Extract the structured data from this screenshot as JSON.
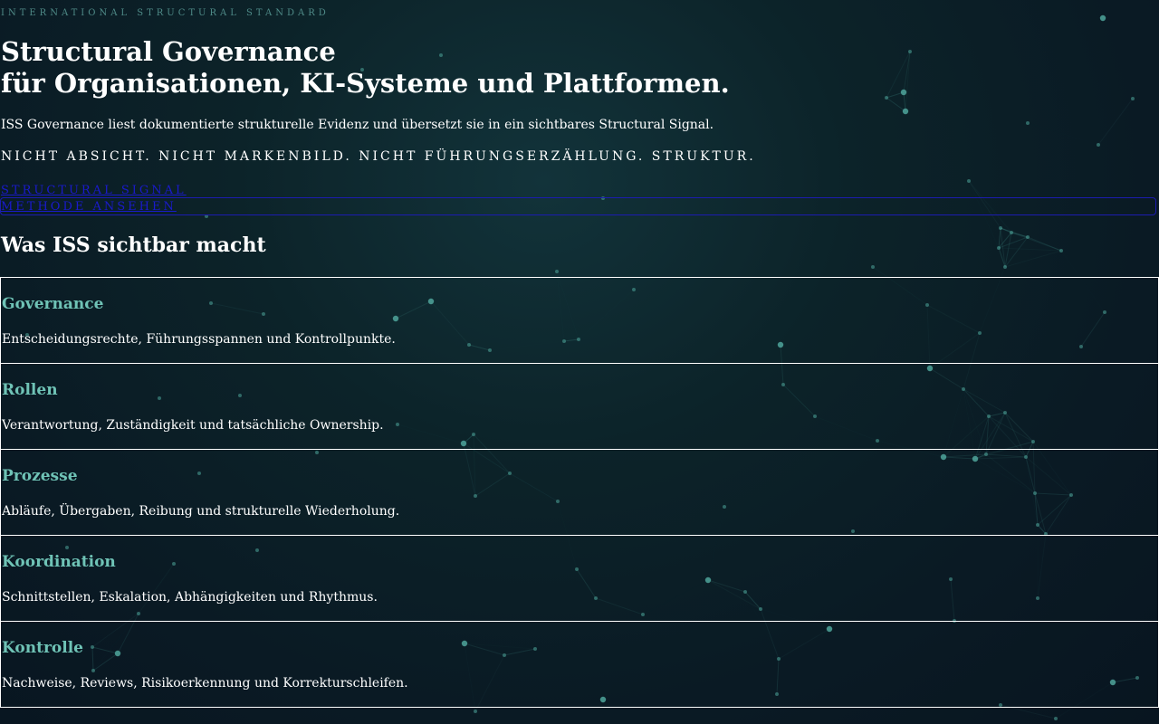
{
  "hero": {
    "eyebrow": "INTERNATIONAL STRUCTURAL STANDARD",
    "title_line1": "Structural Governance",
    "title_line2": "für Organisationen, KI-Systeme und Plattformen.",
    "lead": "ISS Governance liest dokumentierte strukturelle Evidenz und übersetzt sie in ein sichtbares Structural Signal.",
    "statement": "NICHT ABSICHT. NICHT MARKENBILD. NICHT FÜHRUNGSERZÄHLUNG. STRUKTUR.",
    "cta_line1": "STRUCTURAL SIGNAL",
    "cta_line2": "METHODE ANSEHEN"
  },
  "section": {
    "title": "Was ISS sichtbar macht"
  },
  "cards": [
    {
      "title": "Governance",
      "text": "Entscheidungsrechte, Führungsspannen und Kontrollpunkte."
    },
    {
      "title": "Rollen",
      "text": "Verantwortung, Zuständigkeit und tatsächliche Ownership."
    },
    {
      "title": "Prozesse",
      "text": "Abläufe, Übergaben, Reibung und strukturelle Wiederholung."
    },
    {
      "title": "Koordination",
      "text": "Schnittstellen, Eskalation, Abhängigkeiten und Rhythmus."
    },
    {
      "title": "Kontrolle",
      "text": "Nachweise, Reviews, Risikoerkennung und Korrekturschleifen."
    }
  ],
  "colors": {
    "background": "#0a1a24",
    "accent": "#6fc3b6",
    "eyebrow": "#4f8b88",
    "link": "#1a1acc"
  }
}
